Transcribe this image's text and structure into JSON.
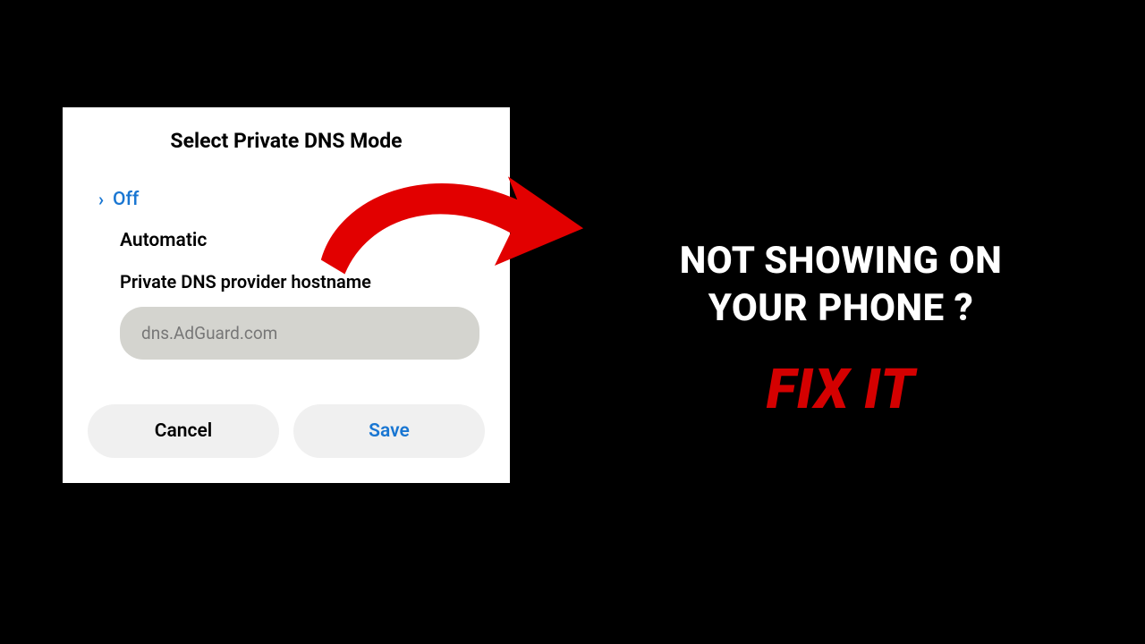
{
  "dialog": {
    "title": "Select Private DNS Mode",
    "options": {
      "off": "Off",
      "automatic": "Automatic",
      "hostname_label": "Private DNS provider hostname"
    },
    "hostname_value": "dns.AdGuard.com",
    "buttons": {
      "cancel": "Cancel",
      "save": "Save"
    }
  },
  "overlay": {
    "headline_line1": "NOT SHOWING ON",
    "headline_line2": "YOUR PHONE ?",
    "fixit": "FIX IT"
  },
  "colors": {
    "accent_blue": "#1976d2",
    "accent_red": "#d40000"
  }
}
